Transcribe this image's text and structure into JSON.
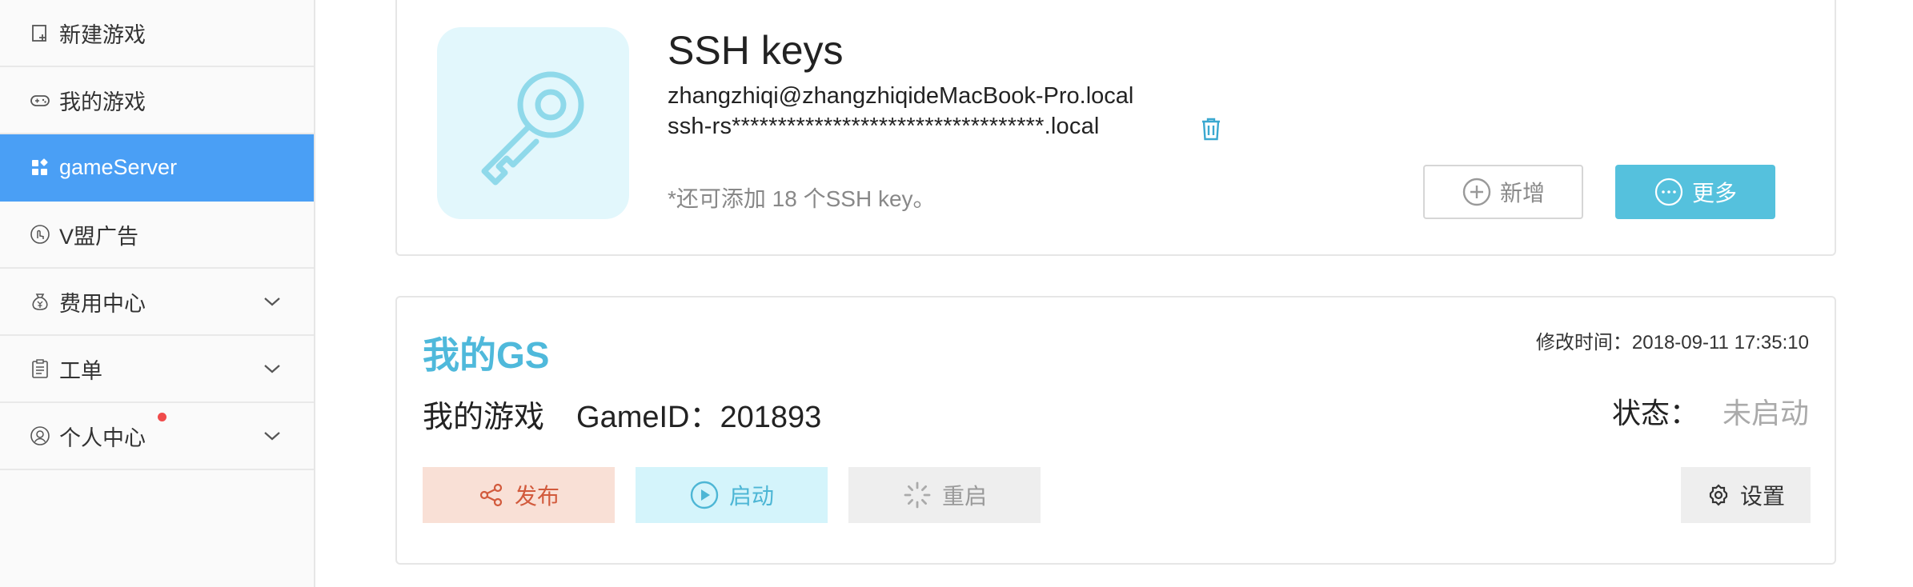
{
  "sidebar": {
    "items": [
      {
        "label": "新建游戏",
        "icon": "new-file-icon"
      },
      {
        "label": "我的游戏",
        "icon": "gamepad-icon"
      },
      {
        "label": "gameServer",
        "icon": "apps-grid-icon",
        "active": true
      },
      {
        "label": "V盟广告",
        "icon": "hand-pointer-icon"
      },
      {
        "label": "费用中心",
        "icon": "money-bag-icon",
        "expandable": true
      },
      {
        "label": "工单",
        "icon": "clipboard-icon",
        "expandable": true
      },
      {
        "label": "个人中心",
        "icon": "user-icon",
        "expandable": true,
        "notification_dot": true
      }
    ]
  },
  "ssh": {
    "title": "SSH keys",
    "email": "zhangzhiqi@zhangzhiqideMacBook-Pro.local",
    "fingerprint": "ssh-rs**********************************.local",
    "note": "*还可添加 18 个SSH key。",
    "new_label": "新增",
    "more_label": "更多"
  },
  "gs": {
    "title": "我的GS",
    "modified": "修改时间：2018-09-11 17:35:10",
    "game_name": "我的游戏",
    "game_id": "GameID：201893",
    "status_label": "状态：",
    "status_value": "未启动",
    "publish_label": "发布",
    "start_label": "启动",
    "restart_label": "重启",
    "settings_label": "设置"
  },
  "colors": {
    "accent_blue": "#4a9ff5",
    "teal": "#55c1dd",
    "title_teal": "#4fb9db",
    "publish_bg": "#f9e0d6",
    "publish_fg": "#d25a3c",
    "notify_red": "#f04b4b"
  }
}
